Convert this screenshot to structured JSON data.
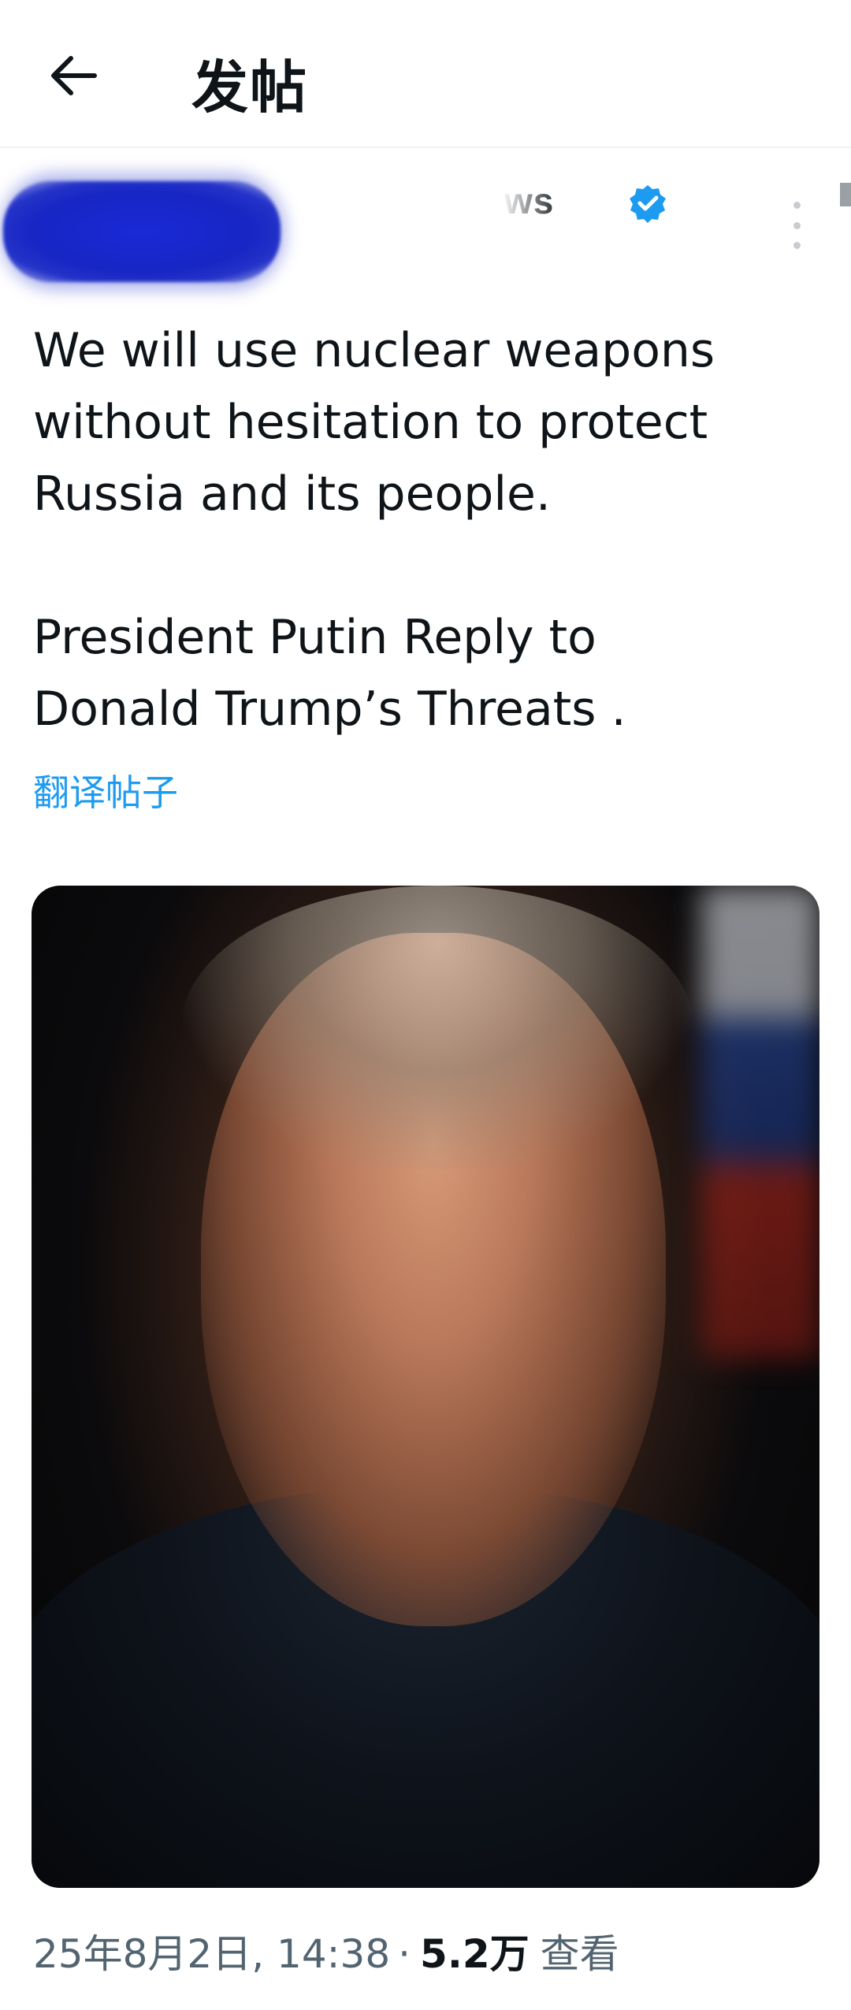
{
  "header": {
    "title": "发帖",
    "back_icon": "arrow-left-icon"
  },
  "author": {
    "handle_visible": "ws",
    "verified_color": "#1d9bf0"
  },
  "tweet": {
    "text": "We will use nuclear weapons\nwithout hesitation to protect\nRussia and its people.\n\nPresident Putin Reply to\nDonald Trump’s Threats .",
    "translate_label": "翻译帖子"
  },
  "meta": {
    "timestamp": "25年8月2日, 14:38",
    "separator": "·",
    "views_count": "5.2万",
    "views_label": "查看"
  },
  "colors": {
    "accent": "#1d9bf0",
    "text_primary": "#0f1419",
    "text_secondary": "#536471"
  }
}
